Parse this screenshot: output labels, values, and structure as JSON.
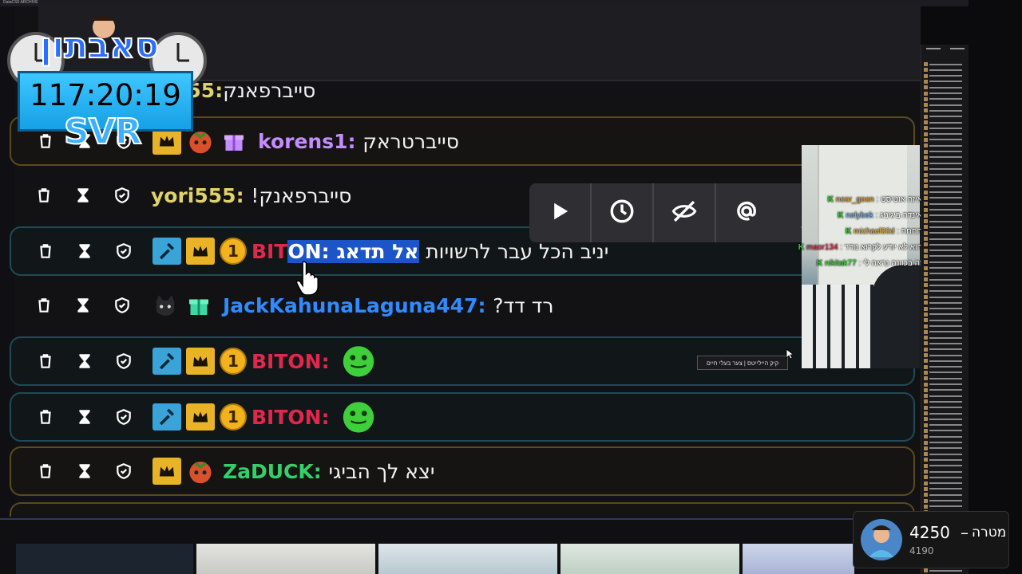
{
  "window": {
    "title": "DataCS5 ARCHIVE"
  },
  "overlay": {
    "logo_text": "סאבתון",
    "timer": "117:20:19",
    "tag": "SVR"
  },
  "chat": {
    "rows": [
      {
        "user": "555",
        "message": "סייברפאנק"
      },
      {
        "user": "korens1",
        "user_color": "#c58cff",
        "message": "סייברטראק"
      },
      {
        "user": "yori555",
        "user_color": "#e0d26a",
        "message": "!סייברפאנק"
      },
      {
        "user_prefix": "BIT",
        "user_suffix": "ON",
        "user_color": "#e0284c",
        "message_highlight": "אל תדאג",
        "message": "יניב הכל עבר לרשויות",
        "coin": "1"
      },
      {
        "user": "JackKahunaLaguna447",
        "user_color": "#2f8bff",
        "message": "?רד דד"
      },
      {
        "user": "BITON",
        "user_color": "#e0284c",
        "coin": "1"
      },
      {
        "user": "BITON",
        "user_color": "#e0284c",
        "coin": "1"
      },
      {
        "user": "ZaDUCK",
        "user_color": "#33d06a",
        "message": "יצא לך הביגי"
      }
    ]
  },
  "overlay_chat": [
    {
      "user": "noor_goon",
      "user_color": "#e69a2a",
      "message": "איזה אוטיסט"
    },
    {
      "user": "nelybek",
      "user_color": "#6fb4ff",
      "message": "אינדה ביגיניג"
    },
    {
      "user": "michael00d",
      "user_color": "#e6b532",
      "message": "חחחח"
    },
    {
      "user": "maor134",
      "user_color": "#e03050",
      "message": "הוא לא יודע לקרוא נודר"
    },
    {
      "user": "nikitak77",
      "user_color": "#35d335",
      "message": "זה בכוונה נראה לי"
    }
  ],
  "tooltip": "קיק היילייטס | צער בעלי חיים",
  "goal": {
    "current": "4250",
    "dash": "–",
    "label": "מטרה",
    "sub": "4190"
  },
  "icons": {
    "delete": "trash-icon",
    "timeout": "hourglass-icon",
    "mod": "shield-icon",
    "hammer": "hammer-icon",
    "crown": "crown-icon",
    "gift": "gift-icon",
    "play": "play-icon",
    "clock": "clock-icon",
    "hide": "eye-slash-icon",
    "mention": "at-icon"
  }
}
